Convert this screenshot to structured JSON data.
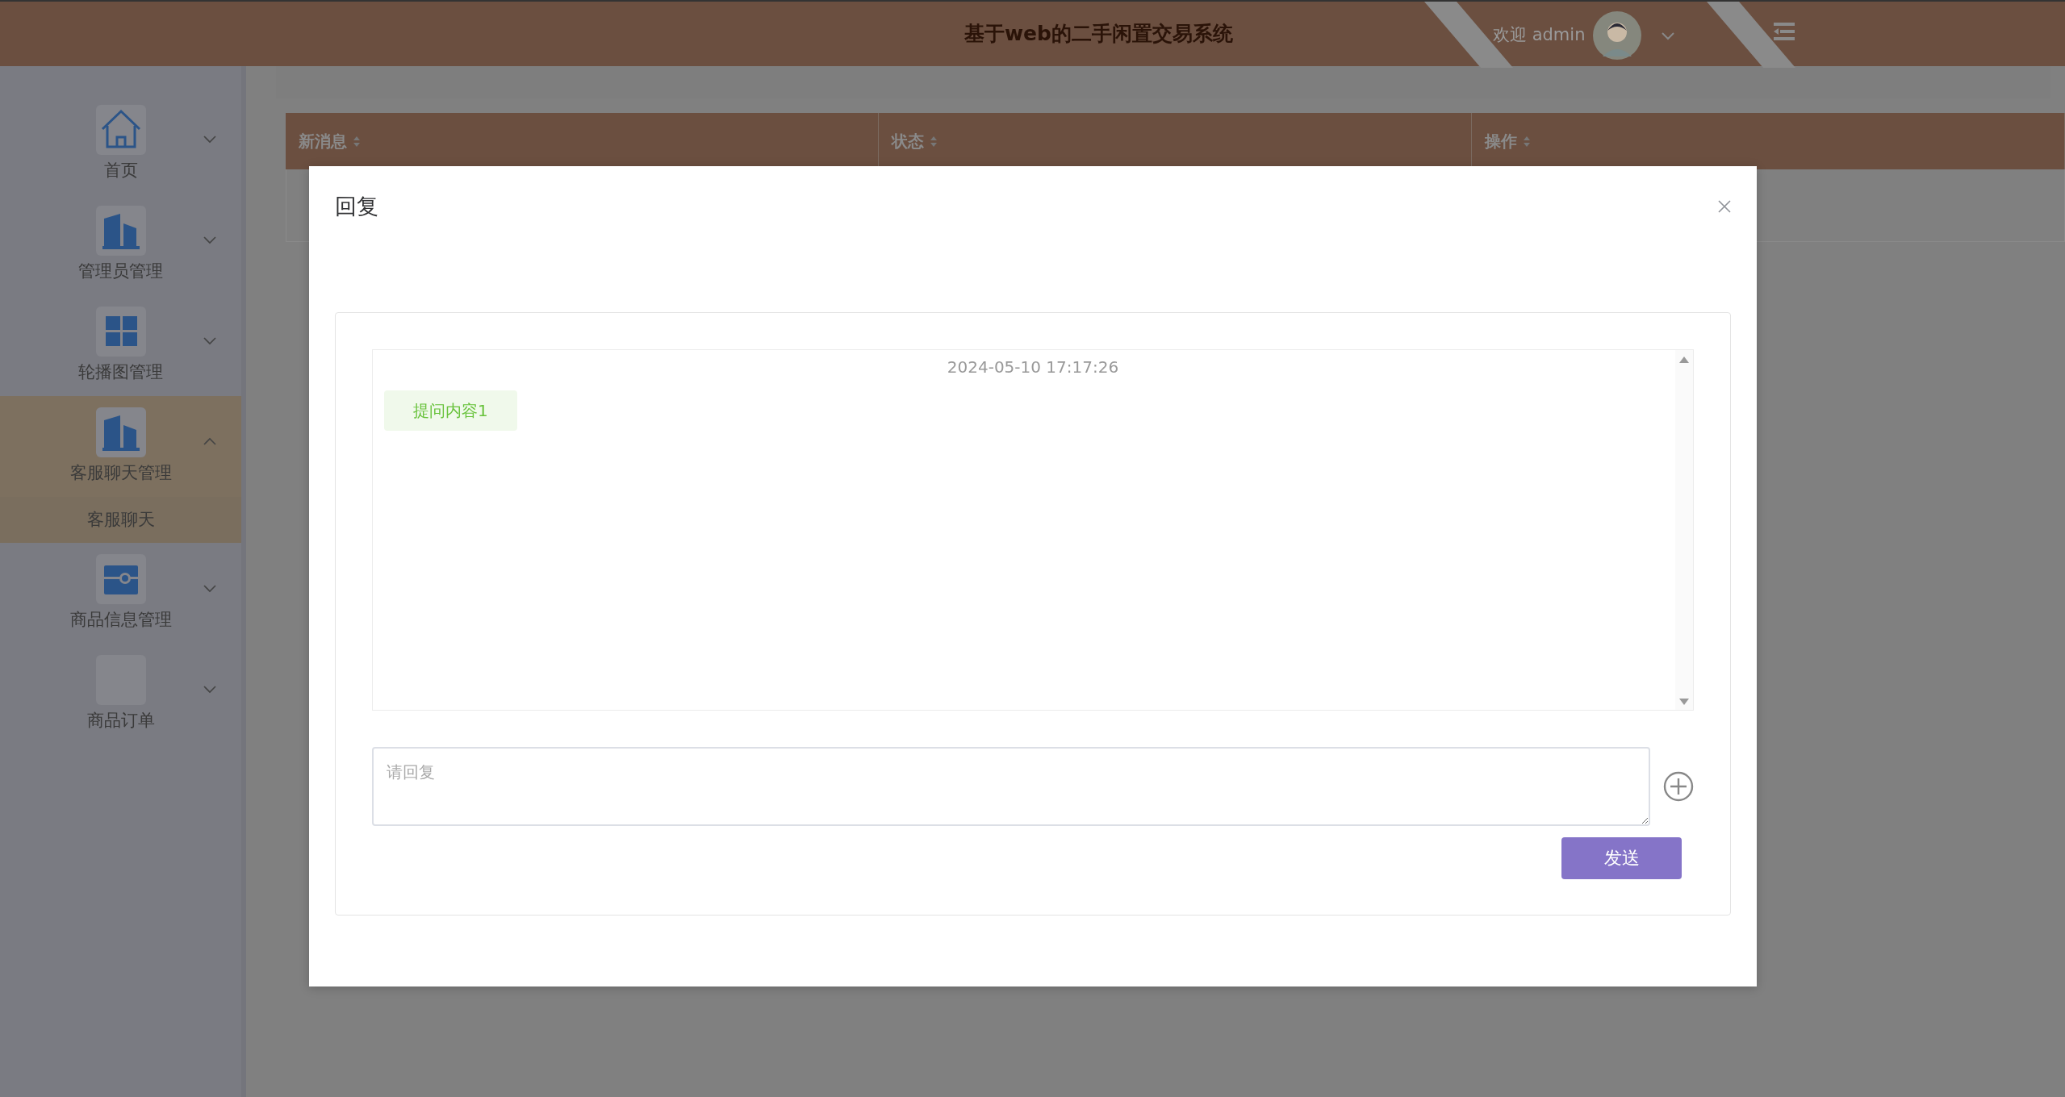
{
  "header": {
    "title": "基于web的二手闲置交易系统",
    "welcome": "欢迎 admin"
  },
  "sidebar": {
    "items": [
      {
        "label": "首页",
        "kind": "home",
        "expanded": false
      },
      {
        "label": "管理员管理",
        "kind": "building",
        "expanded": false
      },
      {
        "label": "轮播图管理",
        "kind": "grid",
        "expanded": false
      },
      {
        "label": "客服聊天管理",
        "kind": "building",
        "expanded": true,
        "children": [
          {
            "label": "客服聊天",
            "selected": true
          }
        ]
      },
      {
        "label": "商品信息管理",
        "kind": "wallet",
        "expanded": false
      },
      {
        "label": "商品订单",
        "kind": "blank",
        "expanded": false
      }
    ]
  },
  "table": {
    "columns": [
      "新消息",
      "状态",
      "操作"
    ]
  },
  "modal": {
    "title": "回复",
    "chat": {
      "time": "2024-05-10 17:17:26",
      "messages": [
        {
          "text": "提问内容1",
          "kind": "question"
        }
      ]
    },
    "reply": {
      "placeholder": "请回复"
    },
    "send_button": "发送"
  }
}
